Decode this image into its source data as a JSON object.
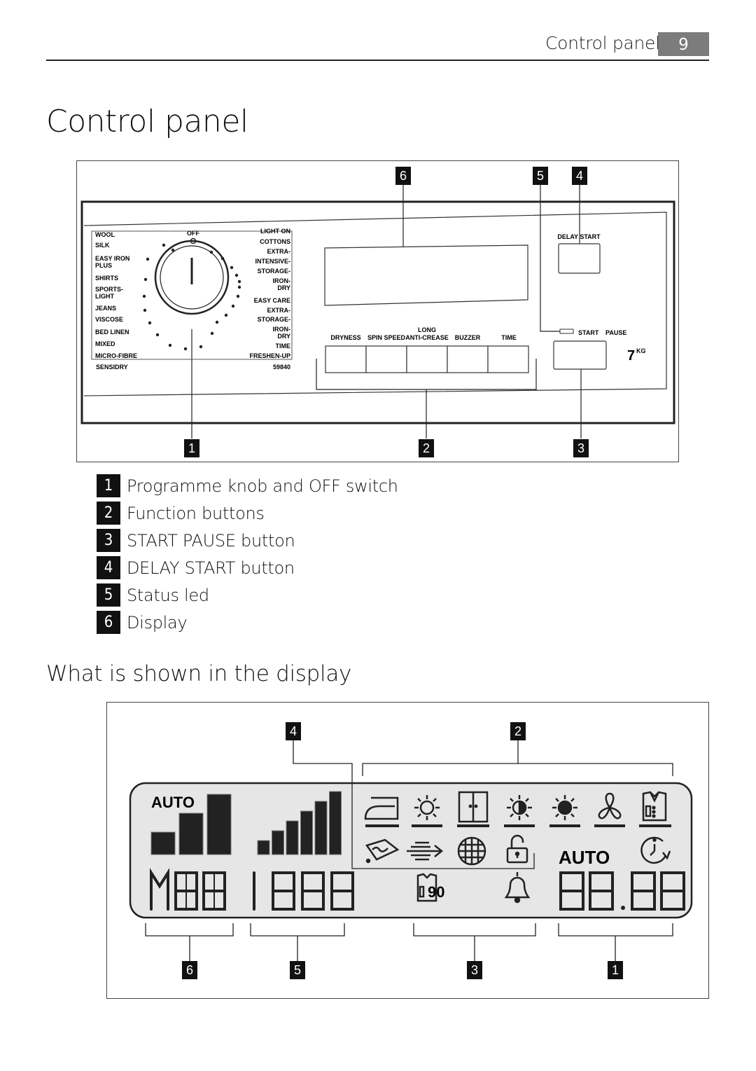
{
  "header": {
    "section_title": "Control panel",
    "page_number": "9"
  },
  "page_title": "Control panel",
  "panel_figure": {
    "callouts_top": [
      "6",
      "5",
      "4"
    ],
    "callouts_bottom": [
      "1",
      "2",
      "3"
    ],
    "knob": {
      "off_label": "OFF",
      "left_programmes": [
        "WOOL",
        "SILK",
        "EASY IRON PLUS",
        "SHIRTS",
        "SPORTS-LIGHT",
        "JEANS",
        "VISCOSE",
        "BED LINEN",
        "MIXED",
        "MICRO-FIBRE"
      ],
      "left_display": [
        [
          "WOOL"
        ],
        [
          "SILK"
        ],
        [
          "EASY IRON",
          "PLUS"
        ],
        [
          "SHIRTS"
        ],
        [
          "SPORTS-",
          "LIGHT"
        ],
        [
          "JEANS"
        ],
        [
          "VISCOSE"
        ],
        [
          "BED LINEN"
        ],
        [
          "MIXED"
        ],
        [
          "MICRO-FIBRE"
        ]
      ],
      "right_programmes": [
        "LIGHT ON",
        "COTTONS EXTRA-",
        "INTENSIVE-",
        "STORAGE-",
        "IRON-DRY",
        "EASY CARE EXTRA-",
        "STORAGE-",
        "IRON-DRY",
        "TIME",
        "FRESHEN-UP"
      ],
      "right_display": [
        [
          "LIGHT ON"
        ],
        [
          "COTTONS"
        ],
        [
          "EXTRA-"
        ],
        [
          "INTENSIVE-"
        ],
        [
          "STORAGE-"
        ],
        [
          "IRON-",
          "DRY"
        ],
        [
          "EASY CARE"
        ],
        [
          "EXTRA-"
        ],
        [
          "STORAGE-"
        ],
        [
          "IRON-",
          "DRY"
        ],
        [
          "TIME"
        ],
        [
          "FRESHEN-UP"
        ]
      ],
      "brand_label": "SENSIDRY",
      "model_number": "59840"
    },
    "function_buttons": [
      {
        "label": "DRYNESS"
      },
      {
        "label": "SPIN SPEED"
      },
      {
        "label_top": "LONG",
        "label": "ANTI-CREASE"
      },
      {
        "label": "BUZZER"
      },
      {
        "label": "TIME"
      }
    ],
    "delay_start_label": "DELAY START",
    "start_label": "START",
    "pause_label": "PAUSE",
    "capacity": "7",
    "capacity_unit": "KG"
  },
  "legend": [
    {
      "num": "1",
      "text": "Programme knob and OFF switch"
    },
    {
      "num": "2",
      "text": "Function buttons"
    },
    {
      "num": "3",
      "text": "START PAUSE button"
    },
    {
      "num": "4",
      "text": "DELAY START button"
    },
    {
      "num": "5",
      "text": "Status led"
    },
    {
      "num": "6",
      "text": "Display"
    }
  ],
  "section_heading": "What is shown in the display",
  "display_figure": {
    "callouts_top": [
      "4",
      "2"
    ],
    "callouts_bottom": [
      "6",
      "5",
      "3",
      "1"
    ],
    "auto_label_left": "AUTO",
    "auto_label_right": "AUTO",
    "dryness_bars": 3,
    "spin_bars": 6,
    "programme_chars": "M88",
    "spin_digits": "1888",
    "time_digits": "88.88",
    "function_icons_row1": [
      "iron-dry-icon",
      "extra-dry-icon",
      "cupboard-dry-icon",
      "half-sun-icon",
      "full-sun-icon",
      "fan-icon",
      "shirt-icon"
    ],
    "function_icons_row2": [
      "anti-crease-icon",
      "progress-flow-icon",
      "filter-icon",
      "door-lock-icon"
    ],
    "delay_icon": "delay-clock-icon",
    "status_icons": [
      "shirt-progress-icon",
      "buzzer-bell-icon"
    ],
    "shirt_progress_digits": "90"
  }
}
